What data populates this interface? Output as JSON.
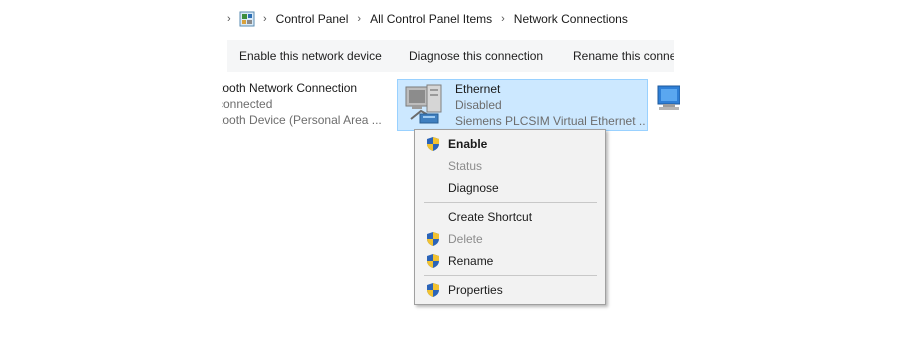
{
  "address_bar": {
    "icon": "control-panel-icon",
    "crumbs": [
      {
        "label": "Control Panel"
      },
      {
        "label": "All Control Panel Items"
      },
      {
        "label": "Network Connections"
      }
    ]
  },
  "toolbar": {
    "enable": "Enable this network device",
    "diagnose": "Diagnose this connection",
    "rename": "Rename this conne"
  },
  "connections": {
    "bluetooth": {
      "name": "Bluetooth Network Connection",
      "status": "Not connected",
      "device": "Bluetooth Device (Personal Area ..."
    },
    "ethernet": {
      "name": "Ethernet",
      "status": "Disabled",
      "device": "Siemens PLCSIM Virtual Ethernet ...",
      "icon": "network-adapter-icon"
    }
  },
  "context_menu": {
    "enable": {
      "label": "Enable",
      "icon": "uac-shield-icon"
    },
    "status": {
      "label": "Status"
    },
    "diagnose": {
      "label": "Diagnose"
    },
    "create_shortcut": {
      "label": "Create Shortcut"
    },
    "delete": {
      "label": "Delete",
      "icon": "uac-shield-icon"
    },
    "rename": {
      "label": "Rename",
      "icon": "uac-shield-icon"
    },
    "properties": {
      "label": "Properties",
      "icon": "uac-shield-icon"
    }
  },
  "colors": {
    "selection_bg": "#cce8ff",
    "selection_border": "#99d1ff",
    "toolbar_bg": "#f5f6f7",
    "menu_bg": "#f2f2f2",
    "disabled_text": "#8c8c8c"
  }
}
